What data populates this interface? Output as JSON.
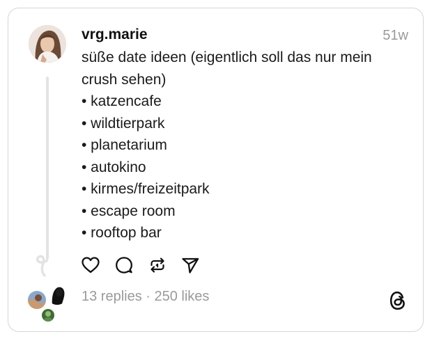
{
  "post": {
    "username": "vrg.marie",
    "timestamp": "51w",
    "text_lines": [
      "süße date ideen (eigentlich soll das nur mein",
      "crush sehen)",
      "• katzencafe",
      "• wildtierpark",
      "• planetarium",
      "• autokino",
      "• kirmes/freizeitpark",
      "• escape room",
      "• rooftop bar"
    ],
    "stats": "13 replies · 250 likes"
  },
  "icons": {
    "like": "heart-icon",
    "reply": "comment-icon",
    "repost": "repost-icon",
    "share": "send-icon",
    "brand": "threads-logo-icon"
  },
  "colors": {
    "text": "#111111",
    "muted": "#9a9a9a",
    "border": "#d6d6d6",
    "thread_line": "#e3e3e3"
  }
}
